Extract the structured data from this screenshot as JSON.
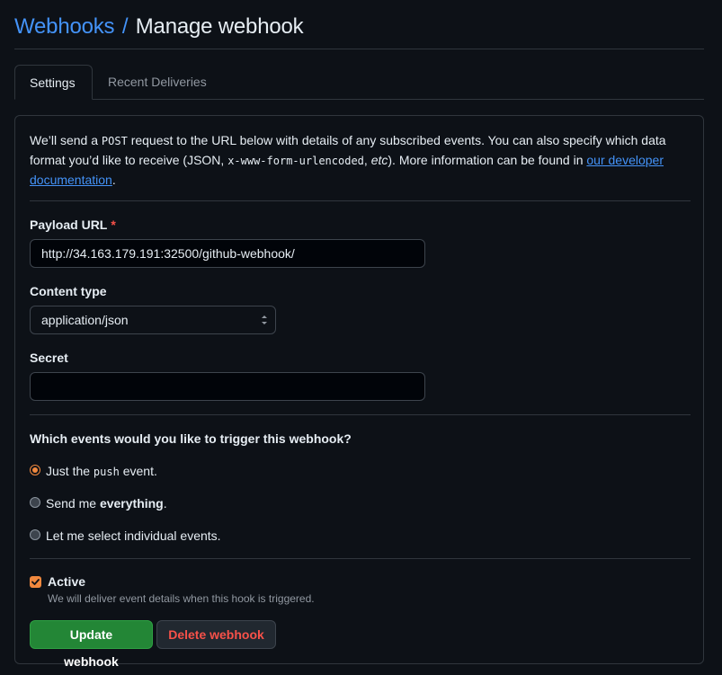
{
  "breadcrumb": {
    "parent": "Webhooks",
    "separator": "/",
    "current": "Manage webhook"
  },
  "tabs": [
    {
      "label": "Settings",
      "active": true
    },
    {
      "label": "Recent Deliveries",
      "active": false
    }
  ],
  "intro": {
    "part1": "We’ll send a ",
    "method": "POST",
    "part2": " request to the URL below with details of any subscribed events. You can also specify which data format you’d like to receive (JSON, ",
    "format": "x-www-form-urlencoded",
    "part3": ", ",
    "etc": "etc",
    "part4": "). More information can be found in ",
    "link": "our developer documentation",
    "part5": "."
  },
  "payload_url": {
    "label": "Payload URL",
    "required_mark": "*",
    "value": "http://34.163.179.191:32500/github-webhook/"
  },
  "content_type": {
    "label": "Content type",
    "selected": "application/json"
  },
  "secret": {
    "label": "Secret",
    "value": ""
  },
  "events": {
    "question": "Which events would you like to trigger this webhook?",
    "options": [
      {
        "pre": "Just the ",
        "code": "push",
        "post": " event.",
        "checked": true
      },
      {
        "pre": "Send me ",
        "bold": "everything",
        "post": ".",
        "checked": false
      },
      {
        "label": "Let me select individual events.",
        "checked": false
      }
    ]
  },
  "active": {
    "label": "Active",
    "checked": true,
    "note": "We will deliver event details when this hook is triggered."
  },
  "buttons": {
    "update": "Update webhook",
    "delete": "Delete webhook"
  },
  "colors": {
    "accent_link": "#4493f8",
    "primary_button": "#238636",
    "danger_text": "#f85149",
    "radio_checked": "#f0883e",
    "background": "#0d1117"
  }
}
